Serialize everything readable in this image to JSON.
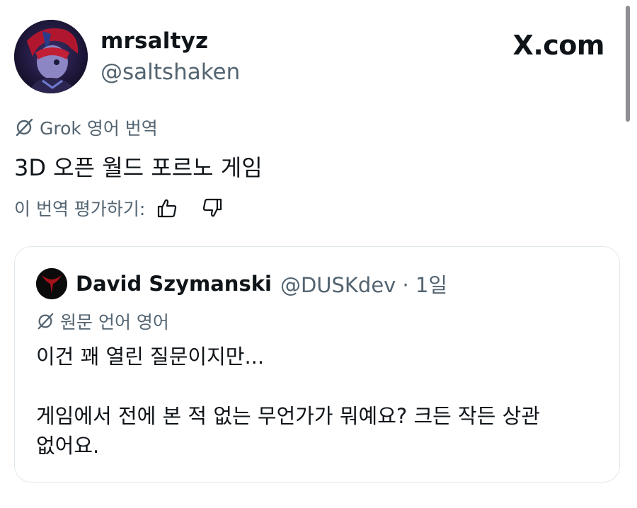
{
  "post": {
    "display_name": "mrsaltyz",
    "handle": "@saltshaken",
    "site_logo": "X.com",
    "translation_label": "Grok 영어 번역",
    "text": "3D 오픈 월드 포르노 게임",
    "rate_prompt": "이 번역 평가하기:"
  },
  "quote": {
    "display_name": "David Szymanski",
    "handle_time": "@DUSKdev · 1일",
    "language_label": "원문 언어 영어",
    "text": "이건 꽤 열린 질문이지만...\n\n게임에서 전에 본 적 없는 무언가가 뭐예요? 크든 작든 상관\n없어요."
  },
  "icons": {
    "translation": "grok-icon",
    "thumbs_up": "thumbs-up-icon",
    "thumbs_down": "thumbs-down-icon"
  },
  "colors": {
    "text_primary": "#0f1419",
    "text_secondary": "#536471",
    "border": "#e1e8ed"
  }
}
